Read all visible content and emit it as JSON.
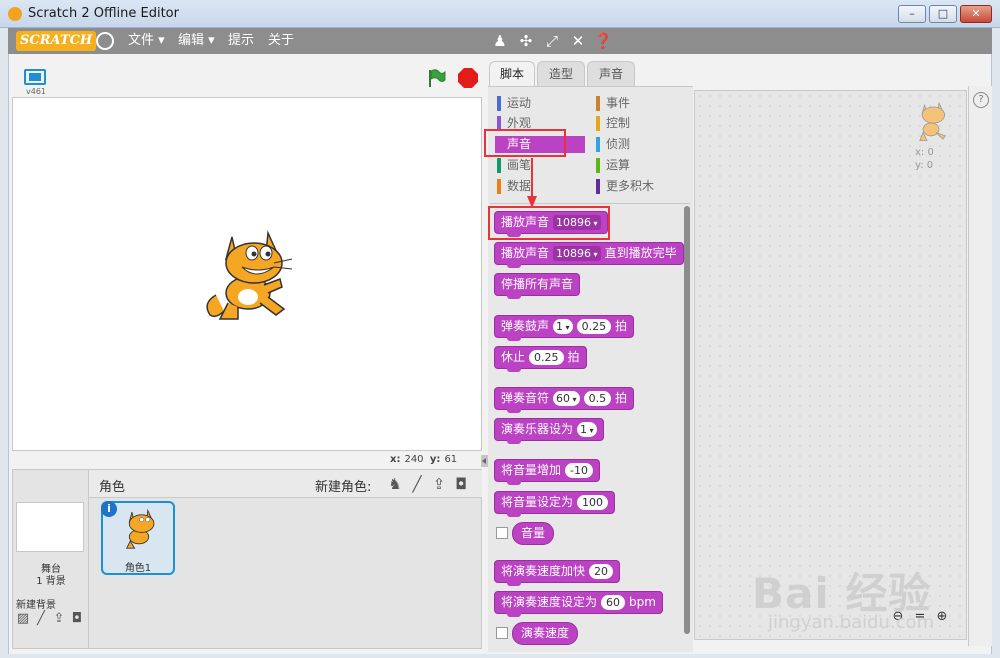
{
  "window": {
    "title": "Scratch 2 Offline Editor",
    "min": "–",
    "max": "□",
    "close": "✕"
  },
  "menu": {
    "logo": "SCRATCH",
    "file": "文件 ▾",
    "edit": "编辑 ▾",
    "tips": "提示",
    "about": "关于"
  },
  "toolbar_icons": [
    "duplicate-icon",
    "delete-icon",
    "grow-icon",
    "shrink-icon",
    "help-icon"
  ],
  "stage": {
    "version": "v461",
    "coords": {
      "x_label": "x:",
      "x": "240",
      "y_label": "y:",
      "y": "61"
    }
  },
  "sprites": {
    "title": "角色",
    "new_sprite": "新建角色:",
    "stage_label": "舞台",
    "backdrops": "1 背景",
    "new_backdrop": "新建背景",
    "sprite_name": "角色1",
    "info": "i"
  },
  "tabs": {
    "scripts": "脚本",
    "costumes": "造型",
    "sounds": "声音"
  },
  "categories": [
    {
      "label": "运动",
      "color": "#4a6cd4"
    },
    {
      "label": "外观",
      "color": "#8a55d7"
    },
    {
      "label": "声音",
      "color": "#bb42c3"
    },
    {
      "label": "画笔",
      "color": "#0e9a6c"
    },
    {
      "label": "数据",
      "color": "#ee7d16"
    },
    {
      "label": "事件",
      "color": "#c88330"
    },
    {
      "label": "控制",
      "color": "#e1a91a"
    },
    {
      "label": "侦测",
      "color": "#2ca5e2"
    },
    {
      "label": "运算",
      "color": "#5cb712"
    },
    {
      "label": "更多积木",
      "color": "#632d99"
    }
  ],
  "blocks": {
    "play_sound": "播放声音",
    "sound_name": "10896",
    "play_until": "直到播放完毕",
    "stop_all": "停播所有声音",
    "drum": "弹奏鼓声",
    "drum_num": "1",
    "drum_beats": "0.25",
    "beats": "拍",
    "rest": "休止",
    "rest_beats": "0.25",
    "note": "弹奏音符",
    "note_num": "60",
    "note_beats": "0.5",
    "instrument": "演奏乐器设为",
    "instrument_num": "1",
    "change_volume": "将音量增加",
    "change_volume_val": "-10",
    "set_volume": "将音量设定为",
    "set_volume_val": "100",
    "volume": "音量",
    "change_tempo": "将演奏速度加快",
    "change_tempo_val": "20",
    "set_tempo": "将演奏速度设定为",
    "set_tempo_val": "60",
    "bpm": "bpm",
    "tempo": "演奏速度"
  },
  "script_area": {
    "x": "x: 0",
    "y": "y: 0"
  },
  "watermark": {
    "main": "Bai 经验",
    "sub": "jingyan.baidu.com"
  }
}
